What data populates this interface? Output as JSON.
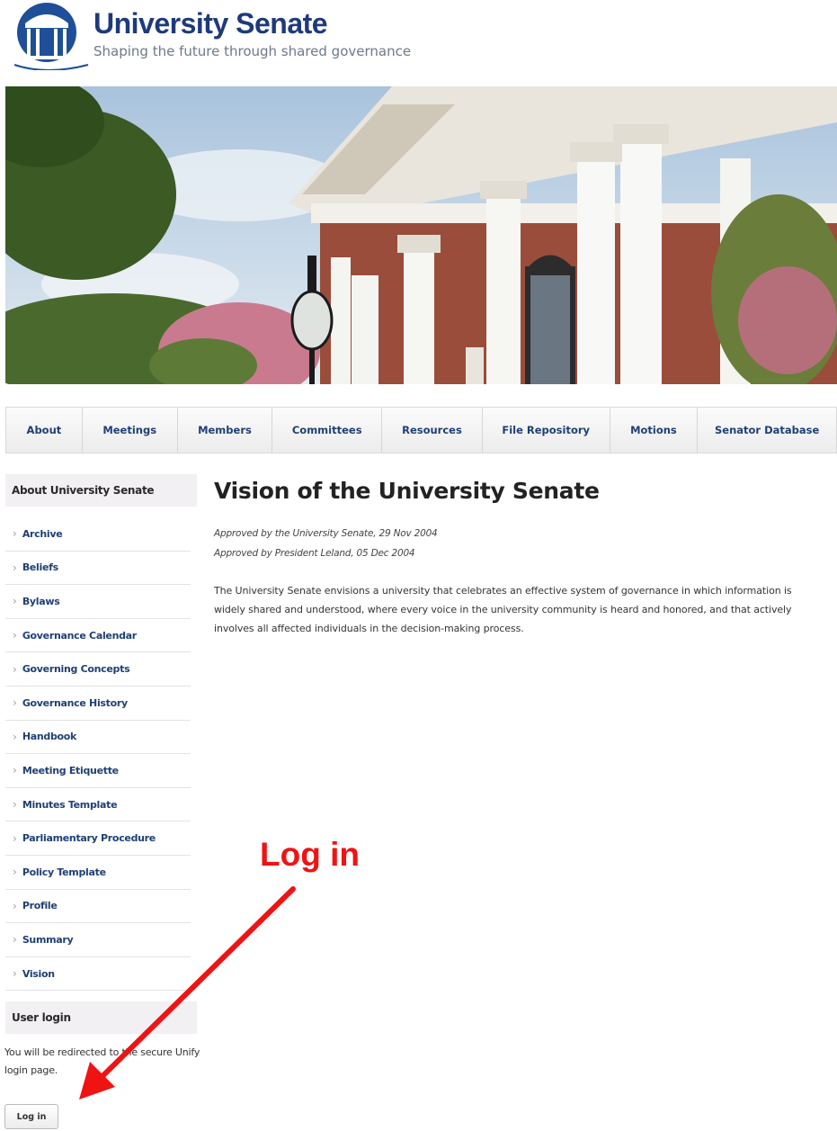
{
  "header": {
    "site_name": "University Senate",
    "slogan": "Shaping the future through shared governance"
  },
  "nav": {
    "items": [
      {
        "label": "About"
      },
      {
        "label": "Meetings"
      },
      {
        "label": "Members"
      },
      {
        "label": "Committees"
      },
      {
        "label": "Resources"
      },
      {
        "label": "File Repository"
      },
      {
        "label": "Motions"
      },
      {
        "label": "Senator Database"
      }
    ]
  },
  "sidebar": {
    "about_title": "About University Senate",
    "items": [
      {
        "label": "Archive"
      },
      {
        "label": "Beliefs"
      },
      {
        "label": "Bylaws"
      },
      {
        "label": "Governance Calendar"
      },
      {
        "label": "Governing Concepts"
      },
      {
        "label": "Governance History"
      },
      {
        "label": "Handbook"
      },
      {
        "label": "Meeting Etiquette"
      },
      {
        "label": "Minutes Template"
      },
      {
        "label": "Parliamentary Procedure"
      },
      {
        "label": "Policy Template"
      },
      {
        "label": "Profile"
      },
      {
        "label": "Summary"
      },
      {
        "label": "Vision"
      }
    ],
    "login_title": "User login",
    "login_text": "You will be redirected to the secure Unify login page.",
    "login_button": "Log in"
  },
  "main": {
    "title": "Vision of the University Senate",
    "approved_1": "Approved by the University Senate, 29 Nov 2004",
    "approved_2": "Approved by President Leland, 05 Dec 2004",
    "body": "The University Senate envisions a university that celebrates an effective system of governance in which information is widely shared and understood, where every voice in the university community is heard and honored, and that actively involves all affected individuals in the decision-making process."
  },
  "annotation": {
    "label": "Log in",
    "color": "#f01313"
  },
  "colors": {
    "brand": "#1e3a7b",
    "link": "#1f3f75"
  }
}
